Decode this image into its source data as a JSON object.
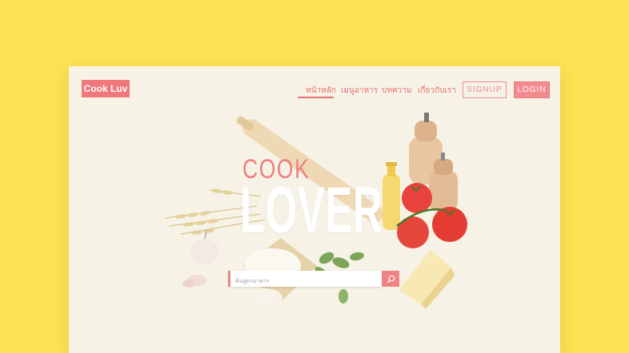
{
  "logo": {
    "text": "Cook Luv"
  },
  "nav": {
    "items": [
      {
        "label": "หน้าหลัก",
        "active": true
      },
      {
        "label": "เมนูอาหาร",
        "active": false
      },
      {
        "label": "บทความ",
        "active": false
      },
      {
        "label": "เกี่ยวกับเรา",
        "active": false
      }
    ],
    "signup_label": "SIGNUP",
    "login_label": "LOGIN"
  },
  "hero": {
    "title_small": "COOK",
    "title_large": "LOVER"
  },
  "search": {
    "placeholder": "ค้นสูตรอาหาร",
    "icon": "search-icon"
  },
  "colors": {
    "background": "#fde253",
    "page": "#f6f3e6",
    "accent": "#f0777a"
  }
}
